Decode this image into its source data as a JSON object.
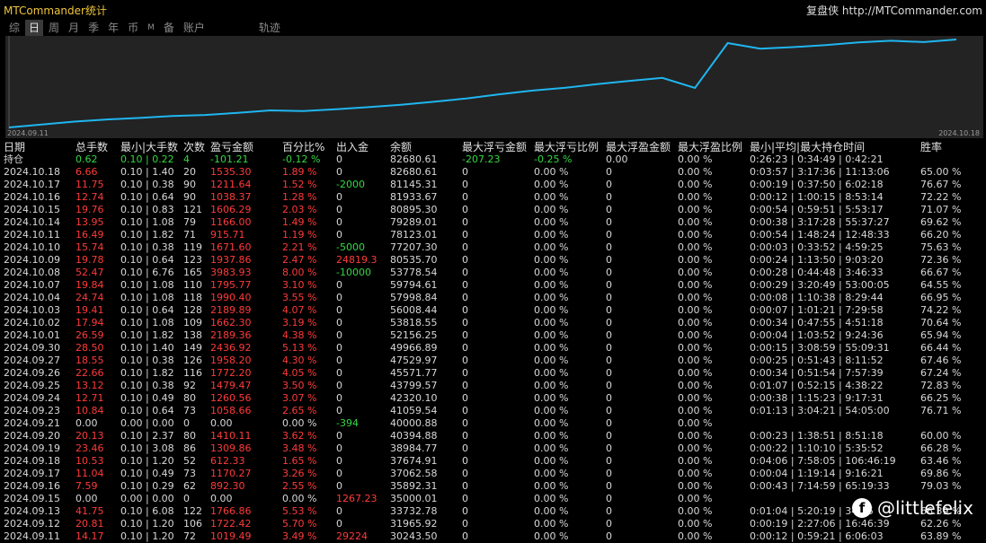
{
  "app_title": "MTCommander统计",
  "brand": {
    "name": "复盘侠",
    "url": "http://MTCommander.com"
  },
  "tabs": [
    {
      "label": "综"
    },
    {
      "label": "日"
    },
    {
      "label": "周"
    },
    {
      "label": "月"
    },
    {
      "label": "季"
    },
    {
      "label": "年"
    },
    {
      "label": "币"
    },
    {
      "label": "M"
    },
    {
      "label": "备"
    },
    {
      "label": "账户"
    },
    {
      "label": "轨迹"
    }
  ],
  "active_tab": 1,
  "chart_data": {
    "type": "line",
    "x_start": "2024.09.11",
    "x_end": "2024.10.18",
    "line_color": "#1fb6f0",
    "x": [
      "2024.09.11",
      "2024.09.12",
      "2024.09.13",
      "2024.09.15",
      "2024.09.16",
      "2024.09.17",
      "2024.09.18",
      "2024.09.19",
      "2024.09.20",
      "2024.09.21",
      "2024.09.23",
      "2024.09.24",
      "2024.09.25",
      "2024.09.26",
      "2024.09.27",
      "2024.09.30",
      "2024.10.01",
      "2024.10.02",
      "2024.10.03",
      "2024.10.04",
      "2024.10.07",
      "2024.10.08",
      "2024.10.09",
      "2024.10.10",
      "2024.10.11",
      "2024.10.14",
      "2024.10.15",
      "2024.10.16",
      "2024.10.17",
      "2024.10.18"
    ],
    "values": [
      30243.5,
      31965.92,
      33732.78,
      35000.01,
      35892.31,
      37062.58,
      37674.91,
      38984.77,
      40394.88,
      40000.88,
      41059.54,
      42320.1,
      43799.57,
      45571.77,
      47529.97,
      49966.89,
      52156.25,
      53818.55,
      56008.44,
      57998.84,
      59794.61,
      53778.54,
      80535.7,
      77207.3,
      78123.01,
      79289.01,
      80895.3,
      81933.67,
      81145.31,
      82680.61
    ]
  },
  "table": {
    "headers": [
      "日期",
      "总手数",
      "最小|大手数",
      "次数",
      "盈亏金额",
      "百分比%",
      "出入金",
      "余额",
      "最大浮亏金额",
      "最大浮亏比例",
      "最大浮盈金额",
      "最大浮盈比例",
      "最小|平均|最大持仓时间",
      "胜率"
    ],
    "hold_row": [
      "持仓",
      "0.62",
      "0.10 | 0.22",
      "4",
      "-101.21",
      "-0.12 %",
      "0",
      "82680.61",
      "-207.23",
      "-0.25 %",
      "0.00",
      "0.00 %",
      "0:26:23 | 0:34:49 | 0:42:21",
      ""
    ],
    "rows": [
      [
        "2024.10.18",
        "6.66",
        "0.10 | 1.40",
        "20",
        "1535.30",
        "1.89 %",
        "0",
        "82680.61",
        "0",
        "0.00 %",
        "0",
        "0.00 %",
        "0:03:57 | 3:17:36 | 11:13:06",
        "65.00 %"
      ],
      [
        "2024.10.17",
        "11.75",
        "0.10 | 0.38",
        "90",
        "1211.64",
        "1.52 %",
        "-2000",
        "81145.31",
        "0",
        "0.00 %",
        "0",
        "0.00 %",
        "0:00:19 | 0:37:50 | 6:02:18",
        "76.67 %"
      ],
      [
        "2024.10.16",
        "12.74",
        "0.10 | 0.64",
        "90",
        "1038.37",
        "1.28 %",
        "0",
        "81933.67",
        "0",
        "0.00 %",
        "0",
        "0.00 %",
        "0:00:12 | 1:00:15 | 8:53:14",
        "72.22 %"
      ],
      [
        "2024.10.15",
        "19.76",
        "0.10 | 0.83",
        "121",
        "1606.29",
        "2.03 %",
        "0",
        "80895.30",
        "0",
        "0.00 %",
        "0",
        "0.00 %",
        "0:00:54 | 0:59:51 | 5:53:17",
        "71.07 %"
      ],
      [
        "2024.10.14",
        "13.95",
        "0.10 | 1.08",
        "79",
        "1166.00",
        "1.49 %",
        "0",
        "79289.01",
        "0",
        "0.00 %",
        "0",
        "0.00 %",
        "0:00:38 | 3:17:28 | 55:37:27",
        "69.62 %"
      ],
      [
        "2024.10.11",
        "16.49",
        "0.10 | 1.82",
        "71",
        "915.71",
        "1.19 %",
        "0",
        "78123.01",
        "0",
        "0.00 %",
        "0",
        "0.00 %",
        "0:00:54 | 1:48:24 | 12:48:33",
        "66.20 %"
      ],
      [
        "2024.10.10",
        "15.74",
        "0.10 | 0.38",
        "119",
        "1671.60",
        "2.21 %",
        "-5000",
        "77207.30",
        "0",
        "0.00 %",
        "0",
        "0.00 %",
        "0:00:03 | 0:33:52 | 4:59:25",
        "75.63 %"
      ],
      [
        "2024.10.09",
        "19.78",
        "0.10 | 0.64",
        "123",
        "1937.86",
        "2.47 %",
        "24819.3",
        "80535.70",
        "0",
        "0.00 %",
        "0",
        "0.00 %",
        "0:00:24 | 1:13:50 | 9:03:20",
        "72.36 %"
      ],
      [
        "2024.10.08",
        "52.47",
        "0.10 | 6.76",
        "165",
        "3983.93",
        "8.00 %",
        "-10000",
        "53778.54",
        "0",
        "0.00 %",
        "0",
        "0.00 %",
        "0:00:28 | 0:44:48 | 3:46:33",
        "66.67 %"
      ],
      [
        "2024.10.07",
        "19.84",
        "0.10 | 1.08",
        "110",
        "1795.77",
        "3.10 %",
        "0",
        "59794.61",
        "0",
        "0.00 %",
        "0",
        "0.00 %",
        "0:00:29 | 3:20:49 | 53:00:05",
        "64.55 %"
      ],
      [
        "2024.10.04",
        "24.74",
        "0.10 | 1.08",
        "118",
        "1990.40",
        "3.55 %",
        "0",
        "57998.84",
        "0",
        "0.00 %",
        "0",
        "0.00 %",
        "0:00:08 | 1:10:38 | 8:29:44",
        "66.95 %"
      ],
      [
        "2024.10.03",
        "19.41",
        "0.10 | 0.64",
        "128",
        "2189.89",
        "4.07 %",
        "0",
        "56008.44",
        "0",
        "0.00 %",
        "0",
        "0.00 %",
        "0:00:07 | 1:01:21 | 7:29:58",
        "74.22 %"
      ],
      [
        "2024.10.02",
        "17.94",
        "0.10 | 1.08",
        "109",
        "1662.30",
        "3.19 %",
        "0",
        "53818.55",
        "0",
        "0.00 %",
        "0",
        "0.00 %",
        "0:00:34 | 0:47:55 | 4:51:18",
        "70.64 %"
      ],
      [
        "2024.10.01",
        "26.59",
        "0.10 | 1.82",
        "138",
        "2189.36",
        "4.38 %",
        "0",
        "52156.25",
        "0",
        "0.00 %",
        "0",
        "0.00 %",
        "0:00:04 | 1:03:52 | 9:24:36",
        "65.94 %"
      ],
      [
        "2024.09.30",
        "28.50",
        "0.10 | 1.40",
        "149",
        "2436.92",
        "5.13 %",
        "0",
        "49966.89",
        "0",
        "0.00 %",
        "0",
        "0.00 %",
        "0:00:15 | 3:08:59 | 55:09:31",
        "66.44 %"
      ],
      [
        "2024.09.27",
        "18.55",
        "0.10 | 0.38",
        "126",
        "1958.20",
        "4.30 %",
        "0",
        "47529.97",
        "0",
        "0.00 %",
        "0",
        "0.00 %",
        "0:00:25 | 0:51:43 | 8:11:52",
        "67.46 %"
      ],
      [
        "2024.09.26",
        "22.66",
        "0.10 | 1.82",
        "116",
        "1772.20",
        "4.05 %",
        "0",
        "45571.77",
        "0",
        "0.00 %",
        "0",
        "0.00 %",
        "0:00:34 | 0:51:54 | 7:57:39",
        "67.24 %"
      ],
      [
        "2024.09.25",
        "13.12",
        "0.10 | 0.38",
        "92",
        "1479.47",
        "3.50 %",
        "0",
        "43799.57",
        "0",
        "0.00 %",
        "0",
        "0.00 %",
        "0:01:07 | 0:52:15 | 4:38:22",
        "72.83 %"
      ],
      [
        "2024.09.24",
        "12.71",
        "0.10 | 0.49",
        "80",
        "1260.56",
        "3.07 %",
        "0",
        "42320.10",
        "0",
        "0.00 %",
        "0",
        "0.00 %",
        "0:00:38 | 1:15:23 | 9:17:31",
        "66.25 %"
      ],
      [
        "2024.09.23",
        "10.84",
        "0.10 | 0.64",
        "73",
        "1058.66",
        "2.65 %",
        "0",
        "41059.54",
        "0",
        "0.00 %",
        "0",
        "0.00 %",
        "0:01:13 | 3:04:21 | 54:05:00",
        "76.71 %"
      ],
      [
        "2024.09.21",
        "0.00",
        "0.00 | 0.00",
        "0",
        "0.00",
        "0.00 %",
        "-394",
        "40000.88",
        "0",
        "0.00 %",
        "0",
        "0.00 %",
        "",
        ""
      ],
      [
        "2024.09.20",
        "20.13",
        "0.10 | 2.37",
        "80",
        "1410.11",
        "3.62 %",
        "0",
        "40394.88",
        "0",
        "0.00 %",
        "0",
        "0.00 %",
        "0:00:23 | 1:38:51 | 8:51:18",
        "60.00 %"
      ],
      [
        "2024.09.19",
        "23.46",
        "0.10 | 3.08",
        "86",
        "1309.86",
        "3.48 %",
        "0",
        "38984.77",
        "0",
        "0.00 %",
        "0",
        "0.00 %",
        "0:00:22 | 1:10:10 | 5:35:52",
        "66.28 %"
      ],
      [
        "2024.09.18",
        "10.53",
        "0.10 | 1.20",
        "52",
        "612.33",
        "1.65 %",
        "0",
        "37674.91",
        "0",
        "0.00 %",
        "0",
        "0.00 %",
        "0:04:06 | 7:58:05 | 106:46:19",
        "63.46 %"
      ],
      [
        "2024.09.17",
        "11.04",
        "0.10 | 0.49",
        "73",
        "1170.27",
        "3.26 %",
        "0",
        "37062.58",
        "0",
        "0.00 %",
        "0",
        "0.00 %",
        "0:00:04 | 1:19:14 | 9:16:21",
        "69.86 %"
      ],
      [
        "2024.09.16",
        "7.59",
        "0.10 | 0.29",
        "62",
        "892.30",
        "2.55 %",
        "0",
        "35892.31",
        "0",
        "0.00 %",
        "0",
        "0.00 %",
        "0:00:43 | 7:14:59 | 65:19:33",
        "79.03 %"
      ],
      [
        "2024.09.15",
        "0.00",
        "0.00 | 0.00",
        "0",
        "0.00",
        "0.00 %",
        "1267.23",
        "35000.01",
        "0",
        "0.00 %",
        "0",
        "0.00 %",
        "",
        ""
      ],
      [
        "2024.09.13",
        "41.75",
        "0.10 | 6.08",
        "122",
        "1766.86",
        "5.53 %",
        "0",
        "33732.78",
        "0",
        "0.00 %",
        "0",
        "0.00 %",
        "0:01:04 | 5:20:19 | 34:55",
        "66.39 %"
      ],
      [
        "2024.09.12",
        "20.81",
        "0.10 | 1.20",
        "106",
        "1722.42",
        "5.70 %",
        "0",
        "31965.92",
        "0",
        "0.00 %",
        "0",
        "0.00 %",
        "0:00:19 | 2:27:06 | 16:46:39",
        "62.26 %"
      ],
      [
        "2024.09.11",
        "14.17",
        "0.10 | 1.20",
        "72",
        "1019.49",
        "3.49 %",
        "29224",
        "30243.50",
        "0",
        "0.00 %",
        "0",
        "0.00 %",
        "0:00:12 | 0:59:21 | 6:06:03",
        "63.89 %"
      ]
    ]
  },
  "watermark": {
    "logo": "f",
    "handle": "@littlefelix"
  }
}
